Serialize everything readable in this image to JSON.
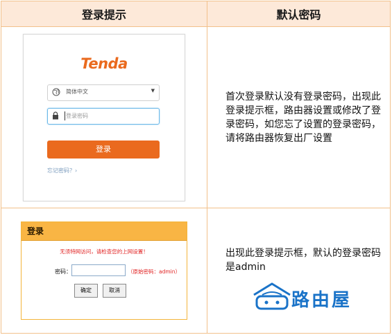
{
  "table": {
    "header_col1": "登录提示",
    "header_col2": "默认密码"
  },
  "tenda": {
    "logo": "Tenda",
    "language": "简体中文",
    "password_placeholder": "登录密码",
    "login_button": "登录",
    "forgot_link": "忘记密码？›",
    "brand_color": "#ea6a1e"
  },
  "row1_description": "首次登录默认没有登录密码，出现此登录提示框，路由器设置或修改了登录密码，如您忘了设置的登录密码，请将路由器恢复出厂设置",
  "classic": {
    "title": "登录",
    "warning": "无须特网访问，请检查您的上网设置！",
    "password_label": "密码：",
    "hint": "（原始密码：admin）",
    "ok_button": "确定",
    "cancel_button": "取消",
    "title_bar_color": "#f9b544"
  },
  "row2_description": "出现此登录提示框，默认的登录密码是admin",
  "watermark": {
    "text": "路由屋",
    "color": "#1a73c8"
  }
}
